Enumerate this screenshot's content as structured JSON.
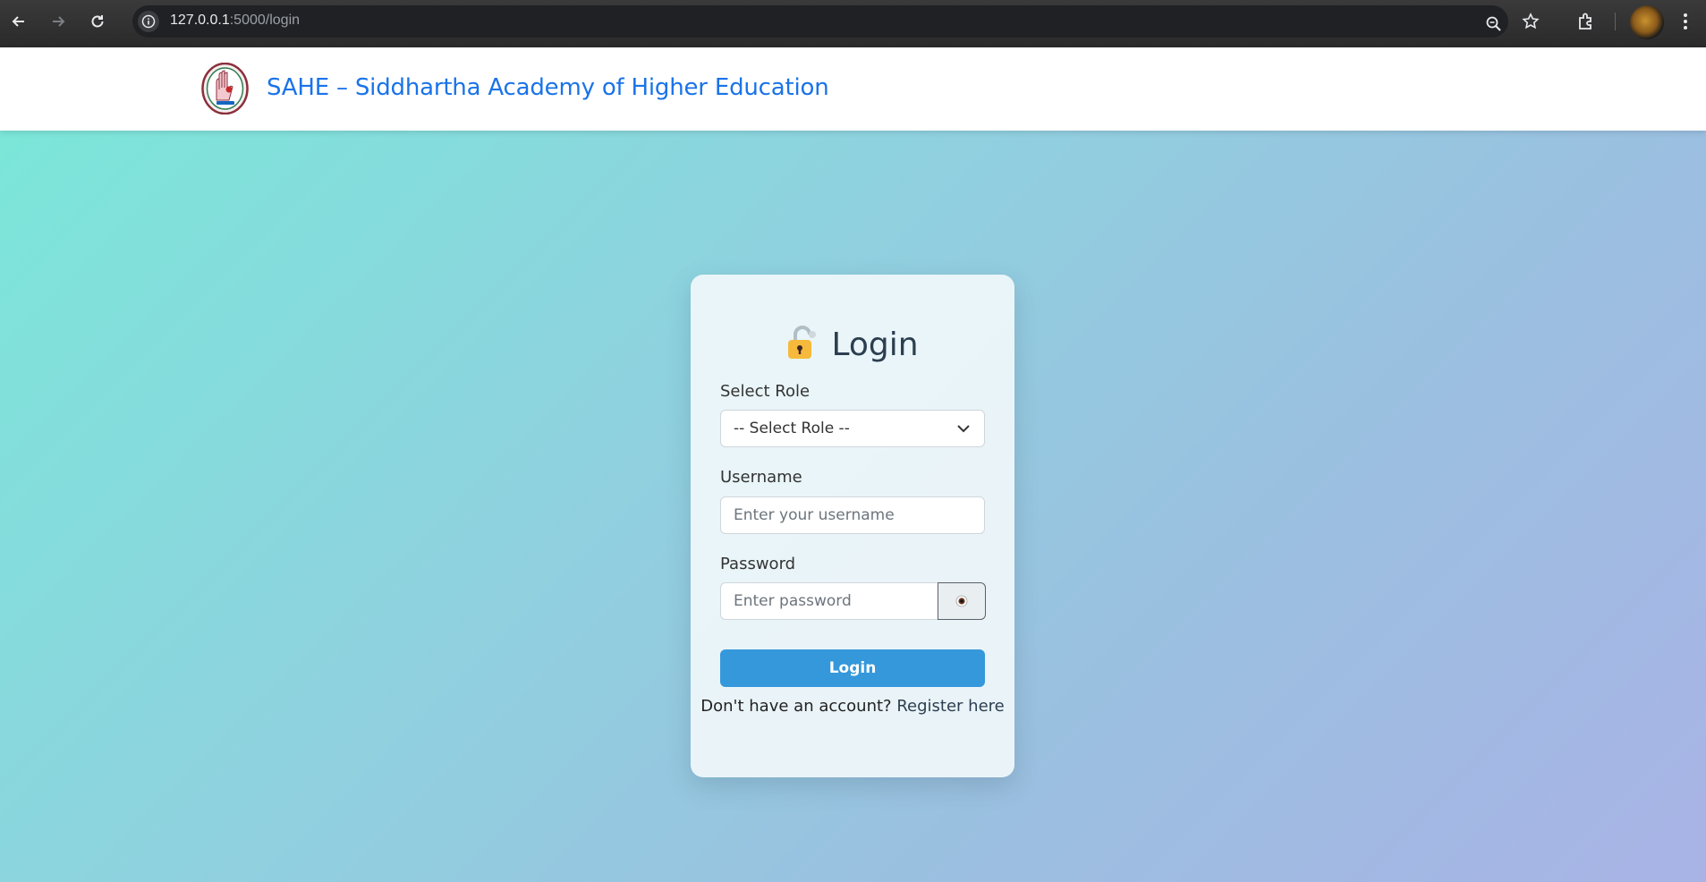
{
  "browser": {
    "url_host": "127.0.0.1",
    "url_path": ":5000/login"
  },
  "navbar": {
    "brand": "SAHE – Siddhartha Academy of Higher Education"
  },
  "login": {
    "title": "Login",
    "role_label": "Select Role",
    "role_selected": "-- Select Role --",
    "username_label": "Username",
    "username_placeholder": "Enter your username",
    "password_label": "Password",
    "password_placeholder": "Enter password",
    "submit_label": "Login",
    "register_prompt": "Don't have an account?",
    "register_link": "Register here"
  },
  "colors": {
    "brand": "#1a73e8",
    "button": "#3498db",
    "title": "#2c3e50"
  }
}
